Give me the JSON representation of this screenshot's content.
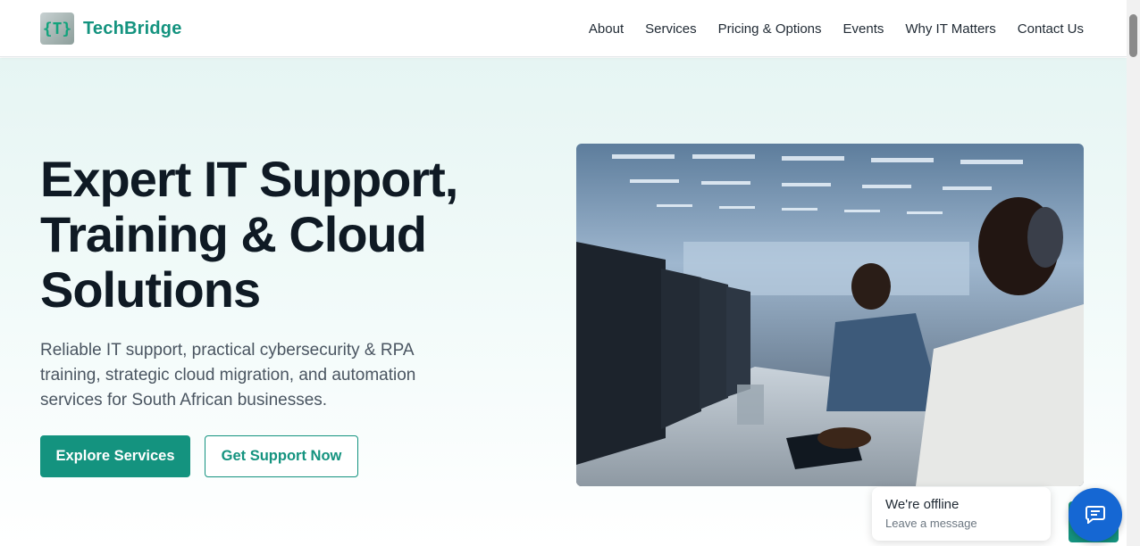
{
  "brand": {
    "logo_glyph": "{T}",
    "name": "TechBridge",
    "accent": "#14937f"
  },
  "nav": {
    "items": [
      "About",
      "Services",
      "Pricing & Options",
      "Events",
      "Why IT Matters",
      "Contact Us"
    ]
  },
  "hero": {
    "headline_line1": "Expert IT Support,",
    "headline_line2": "Training & Cloud",
    "headline_line3": "Solutions",
    "subtext": "Reliable IT support, practical cybersecurity & RPA training, strategic cloud migration, and automation services for South African businesses.",
    "primary_button": "Explore Services",
    "secondary_button": "Get Support Now"
  },
  "chat": {
    "status": "We're offline",
    "prompt": "Leave a message",
    "launcher_icon": "chat-icon",
    "launcher_color": "#1567d3"
  }
}
